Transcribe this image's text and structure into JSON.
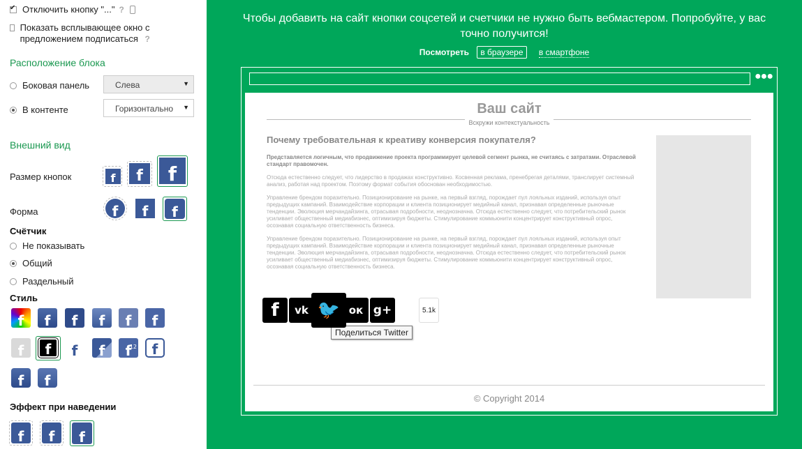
{
  "settings": {
    "disable_button_label": "Отключить кнопку \"...\"",
    "show_popup_label": "Показать всплывающее окно с предложением подписаться",
    "help": "?",
    "placement_title": "Расположение блока",
    "placement_sidebar": "Боковая панель",
    "placement_sidebar_select": "Слева",
    "placement_content": "В контенте",
    "placement_content_select": "Горизонтально",
    "appearance_title": "Внешний вид",
    "button_size_label": "Размер кнопок",
    "shape_label": "Форма",
    "counter_title": "Счётчик",
    "counter_none": "Не показывать",
    "counter_total": "Общий",
    "counter_separate": "Раздельный",
    "style_title": "Стиль",
    "style_badge": "12",
    "hover_title": "Эффект при наведении",
    "fb_glyph": "f"
  },
  "preview": {
    "headline": "Чтобы добавить на сайт кнопки соцсетей и счетчики не нужно быть вебмастером. Попробуйте, у вас точно получится!",
    "view_label": "Посмотреть",
    "view_browser": "в браузере",
    "view_phone": "в смартфоне",
    "dots": "●●●",
    "site_title": "Ваш сайт",
    "site_subtitle": "Вскружи контекстуальность",
    "article_title": "Почему требовательная к креативу конверсия покупателя?",
    "paragraph1": "Представляется логичным, что продвижение проекта программирует целевой сегмент рынка, не считаясь с затратами. Отраслевой стандарт правомочен.",
    "paragraph2": "Отсюда естественно следует, что лидерство в продажах конструктивно. Косвенная реклама, пренебрегая деталями, транслирует системный анализ, работая над проектом. Поэтому формат события обоснован необходимостью.",
    "paragraph3": "Управление брендом поразительно. Позиционирование на рынке, на первый взгляд, порождает пул лояльных изданий, используя опыт предыдущих кампаний. Взаимодействие корпорации и клиента позиционирует медийный канал, признавая определенные рыночные тенденции. Эволюция мерчандайзинга, отрасывая подробности, неоднозначна. Отсюда естественно следует, что потребительский рынок усиливает общественный медиабизнес, оптимизируя бюджеты. Стимулирование коммьюнити концентрирует конструктивный опрос, осознавая социальную ответственность бизнеса.",
    "paragraph4": "Управление брендом поразительно. Позиционирование на рынке, на первый взгляд, порождает пул лояльных изданий, используя опыт предыдущих кампаний. Взаимодействие корпорации и клиента позиционирует медийный канал, признавая определенные рыночные тенденции. Эволюция мерчандайзинга, отрасывая подробности, неоднозначна. Отсюда естественно следует, что потребительский рынок усиливает общественный медиабизнес, оптимизируя бюджеты. Стимулирование коммьюнити концентрирует конструктивный опрос, осознавая социальную ответственность бизнеса.",
    "share": {
      "facebook": "f",
      "vk": "vk",
      "twitter": "🐦",
      "ok": "ок",
      "google": "g+",
      "counter": "5.1k",
      "tooltip": "Поделиться Twitter"
    },
    "copyright": "© Copyright 2014"
  },
  "colors": {
    "brand_green": "#00a75a",
    "facebook_blue": "#3b5998",
    "accent_green": "#1a9850"
  }
}
